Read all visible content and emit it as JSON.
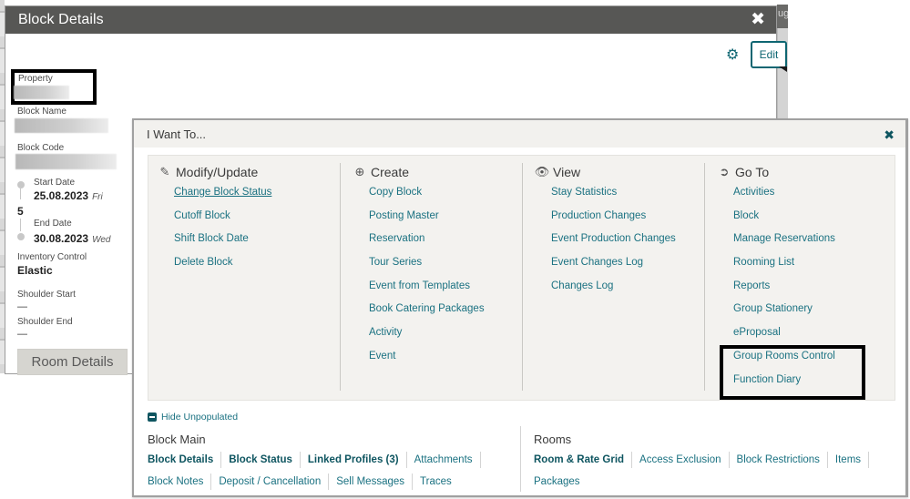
{
  "background": {
    "partial_text": "ug"
  },
  "block_details": {
    "title": "Block Details",
    "close_icon": "close-icon",
    "settings_icon": "gear-icon",
    "edit_label": "Edit",
    "fields": {
      "property_label": "Property",
      "block_name_label": "Block Name",
      "block_code_label": "Block Code",
      "start_date_label": "Start Date",
      "start_date": "25.08.2023",
      "start_day": "Fri",
      "nights": "5",
      "end_date_label": "End Date",
      "end_date": "30.08.2023",
      "end_day": "Wed",
      "inventory_control_label": "Inventory Control",
      "inventory_control": "Elastic",
      "shoulder_start_label": "Shoulder Start",
      "shoulder_start": "—",
      "shoulder_end_label": "Shoulder End",
      "shoulder_end": "—"
    },
    "room_details_label": "Room Details"
  },
  "i_want_to": {
    "title": "I Want To...",
    "close_icon": "close-icon",
    "columns": [
      {
        "title": "Modify/Update",
        "icon": "pencil-icon",
        "items": [
          "Change Block Status",
          "Cutoff Block",
          "Shift Block Date",
          "Delete Block"
        ]
      },
      {
        "title": "Create",
        "icon": "plus-circle-icon",
        "items": [
          "Copy Block",
          "Posting Master",
          "Reservation",
          "Tour Series",
          "Event from Templates",
          "Book Catering Packages",
          "Activity",
          "Event"
        ]
      },
      {
        "title": "View",
        "icon": "eye-icon",
        "items": [
          "Stay Statistics",
          "Production Changes",
          "Event Production Changes",
          "Event Changes Log",
          "Changes Log"
        ]
      },
      {
        "title": "Go To",
        "icon": "arrow-circle-right-icon",
        "items": [
          "Activities",
          "Block",
          "Manage Reservations",
          "Rooming List",
          "Reports",
          "Group Stationery",
          "eProposal",
          "Group Rooms Control",
          "Function Diary"
        ]
      }
    ],
    "hide_unpopulated_label": "Hide Unpopulated",
    "block_main": {
      "title": "Block Main",
      "row1": [
        {
          "label": "Block Details",
          "bold": true
        },
        {
          "label": "Block Status",
          "bold": true
        },
        {
          "label": "Linked Profiles (3)",
          "bold": true
        },
        {
          "label": "Attachments",
          "bold": false
        }
      ],
      "row2": [
        {
          "label": "Block Notes",
          "bold": false
        },
        {
          "label": "Deposit / Cancellation",
          "bold": false
        },
        {
          "label": "Sell Messages",
          "bold": false
        },
        {
          "label": "Traces",
          "bold": false
        }
      ]
    },
    "rooms": {
      "title": "Rooms",
      "row1": [
        {
          "label": "Room & Rate Grid",
          "bold": true
        },
        {
          "label": "Access Exclusion",
          "bold": false
        },
        {
          "label": "Block Restrictions",
          "bold": false
        },
        {
          "label": "Items",
          "bold": false
        }
      ],
      "row2": [
        {
          "label": "Packages",
          "bold": false
        }
      ]
    }
  },
  "colors": {
    "accent": "#1a7181",
    "accent_dark": "#0e5560",
    "header_bg": "#575755",
    "panel_bg": "#f3f2ef"
  }
}
